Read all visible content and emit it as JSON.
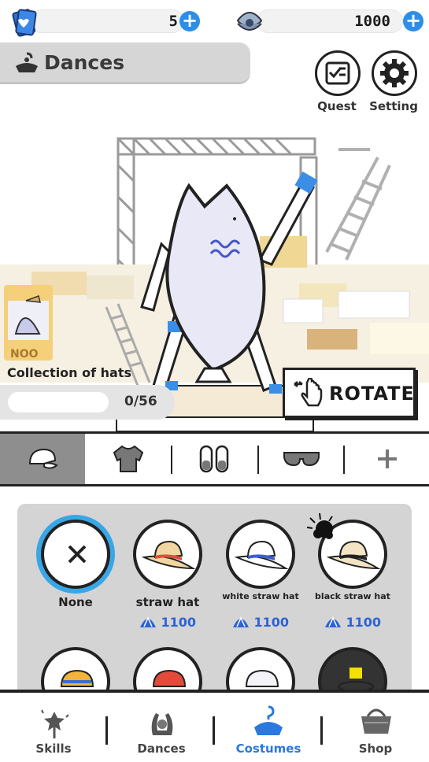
{
  "currencies": {
    "tickets": {
      "value": "5",
      "icon": "ticket-icon"
    },
    "shells": {
      "value": "1000",
      "icon": "oyster-pearl-icon"
    }
  },
  "header": {
    "section_title": "Dances",
    "quest_label": "Quest",
    "setting_label": "Setting"
  },
  "collection": {
    "title": "Collection of hats",
    "progress": "0/56",
    "progress_fraction": 0
  },
  "rotate_label": "ROTATE",
  "categories": [
    {
      "name": "hats",
      "icon": "cap-icon",
      "active": true
    },
    {
      "name": "tops",
      "icon": "sweater-icon",
      "active": false
    },
    {
      "name": "shoes",
      "icon": "sneakers-icon",
      "active": false
    },
    {
      "name": "glasses",
      "icon": "sunglasses-icon",
      "active": false
    },
    {
      "name": "more",
      "icon": "plus-icon",
      "active": false
    }
  ],
  "items": [
    {
      "name": "None",
      "price": "",
      "selected": true
    },
    {
      "name": "straw hat",
      "price": "1100",
      "selected": false
    },
    {
      "name": "white straw hat",
      "price": "1100",
      "selected": false
    },
    {
      "name": "black straw hat",
      "price": "1100",
      "selected": false
    }
  ],
  "nav": {
    "skills": "Skills",
    "dances": "Dances",
    "costumes": "Costumes",
    "shop": "Shop"
  },
  "colors": {
    "accent": "#2d8ee8",
    "price": "#2d63d8",
    "selected_ring": "#39a6e6",
    "active_nav": "#2a78e0"
  }
}
